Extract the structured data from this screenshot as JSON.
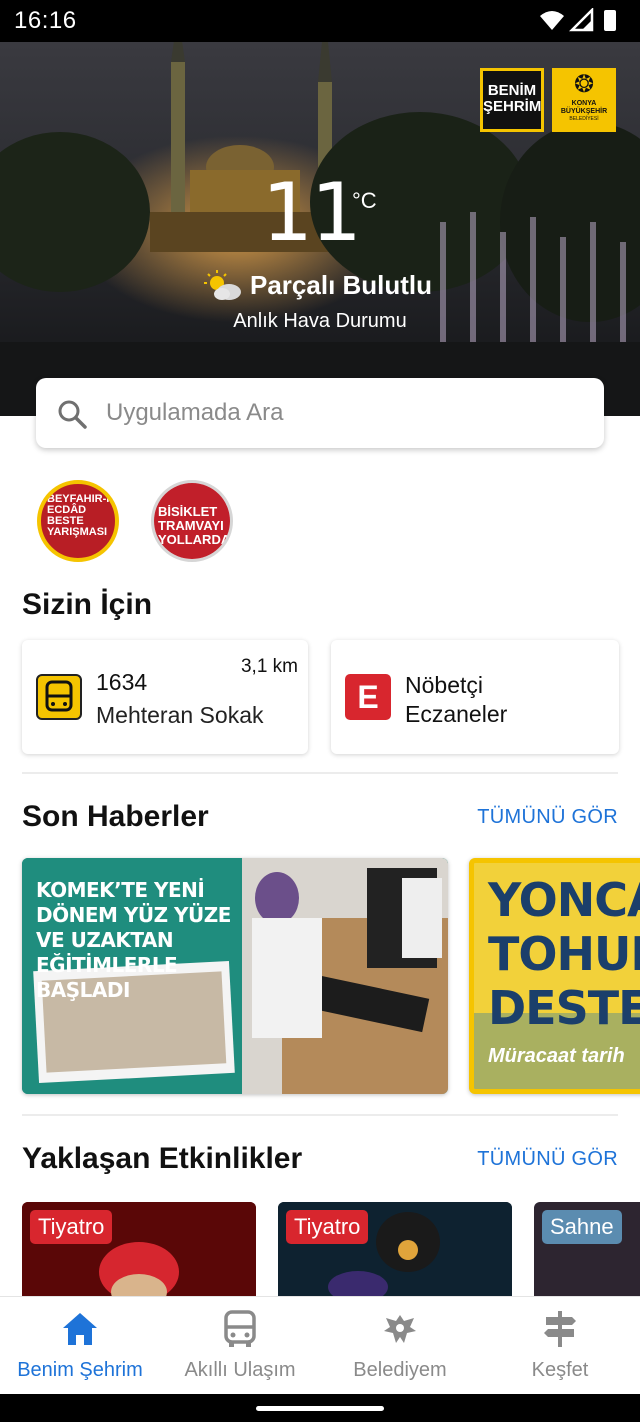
{
  "status_bar": {
    "time": "16:16"
  },
  "branding": {
    "benim_sehrim": "BENİM ŞEHRİM",
    "konya_title": "KONYA BÜYÜKŞEHİR",
    "konya_sub": "BELEDİYESİ"
  },
  "weather": {
    "temperature": "11",
    "unit": "°C",
    "condition": "Parçalı Bulutlu",
    "subtitle": "Anlık Hava Durumu"
  },
  "search": {
    "placeholder": "Uygulamada Ara"
  },
  "stories": [
    {
      "label": "BEYFAHIR-I ECDÂD BESTE YARIŞMASI",
      "icon": "story-thumbnail"
    },
    {
      "label": "BİSİKLET TRAMVAYI YOLLARDA!",
      "icon": "story-thumbnail"
    }
  ],
  "for_you": {
    "title": "Sizin İçin",
    "bus": {
      "line": "1634",
      "stop": "Mehteran Sokak",
      "distance": "3,1 km",
      "icon": "bus-icon"
    },
    "pharmacy": {
      "label": "Nöbetçi Eczaneler",
      "icon_letter": "E"
    }
  },
  "news": {
    "title": "Son Haberler",
    "see_all": "TÜMÜNÜ GÖR",
    "items": [
      {
        "headline": "KOMEK’TE YENİ DÖNEM YÜZ YÜZE VE UZAKTAN EĞİTİMLERLE BAŞLADI"
      },
      {
        "headline": "YONCA TOHUM DESTEĞ",
        "subline": "Müracaat tarih"
      }
    ]
  },
  "events": {
    "title": "Yaklaşan Etkinlikler",
    "see_all": "TÜMÜNÜ GÖR",
    "items": [
      {
        "badge": "Tiyatro"
      },
      {
        "badge": "Tiyatro"
      },
      {
        "badge": "Sahne"
      }
    ]
  },
  "tabbar": {
    "items": [
      {
        "label": "Benim Şehrim",
        "icon": "home-icon",
        "active": true
      },
      {
        "label": "Akıllı Ulaşım",
        "icon": "bus-icon",
        "active": false
      },
      {
        "label": "Belediyem",
        "icon": "eagle-emblem-icon",
        "active": false
      },
      {
        "label": "Keşfet",
        "icon": "signpost-icon",
        "active": false
      }
    ]
  },
  "colors": {
    "accent": "#1e73d8",
    "brand_yellow": "#f5c400",
    "badge_red": "#d8262e",
    "badge_blue": "#5b8cb0"
  }
}
